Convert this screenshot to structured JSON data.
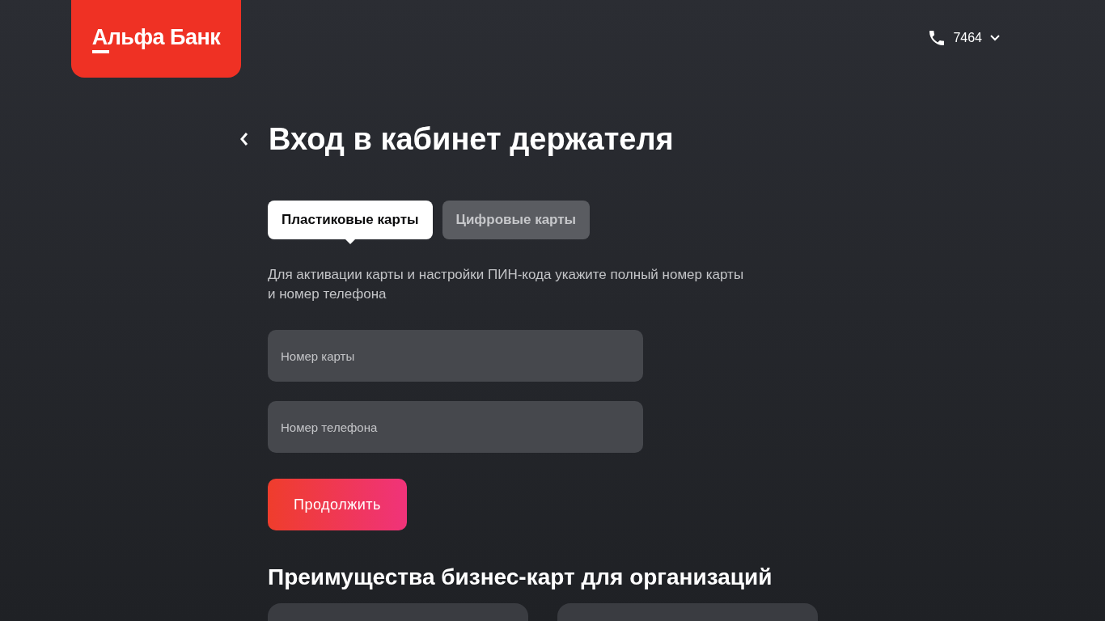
{
  "header": {
    "logo": "Альфа Банк",
    "phone": "7464"
  },
  "title": "Вход в кабинет держателя",
  "tabs": [
    {
      "label": "Пластиковые карты",
      "selected": true
    },
    {
      "label": "Цифровые карты",
      "selected": false
    }
  ],
  "description": "Для активации карты и настройки ПИН-кода укажите полный номер карты и номер телефона",
  "fields": [
    {
      "placeholder": "Номер карты"
    },
    {
      "placeholder": "Номер телефона"
    }
  ],
  "submit": "Продолжить",
  "benefits": {
    "title": "Преимущества бизнес-карт для организаций",
    "cards": [
      {
        "kind": "card"
      },
      {
        "kind": "card"
      }
    ]
  }
}
